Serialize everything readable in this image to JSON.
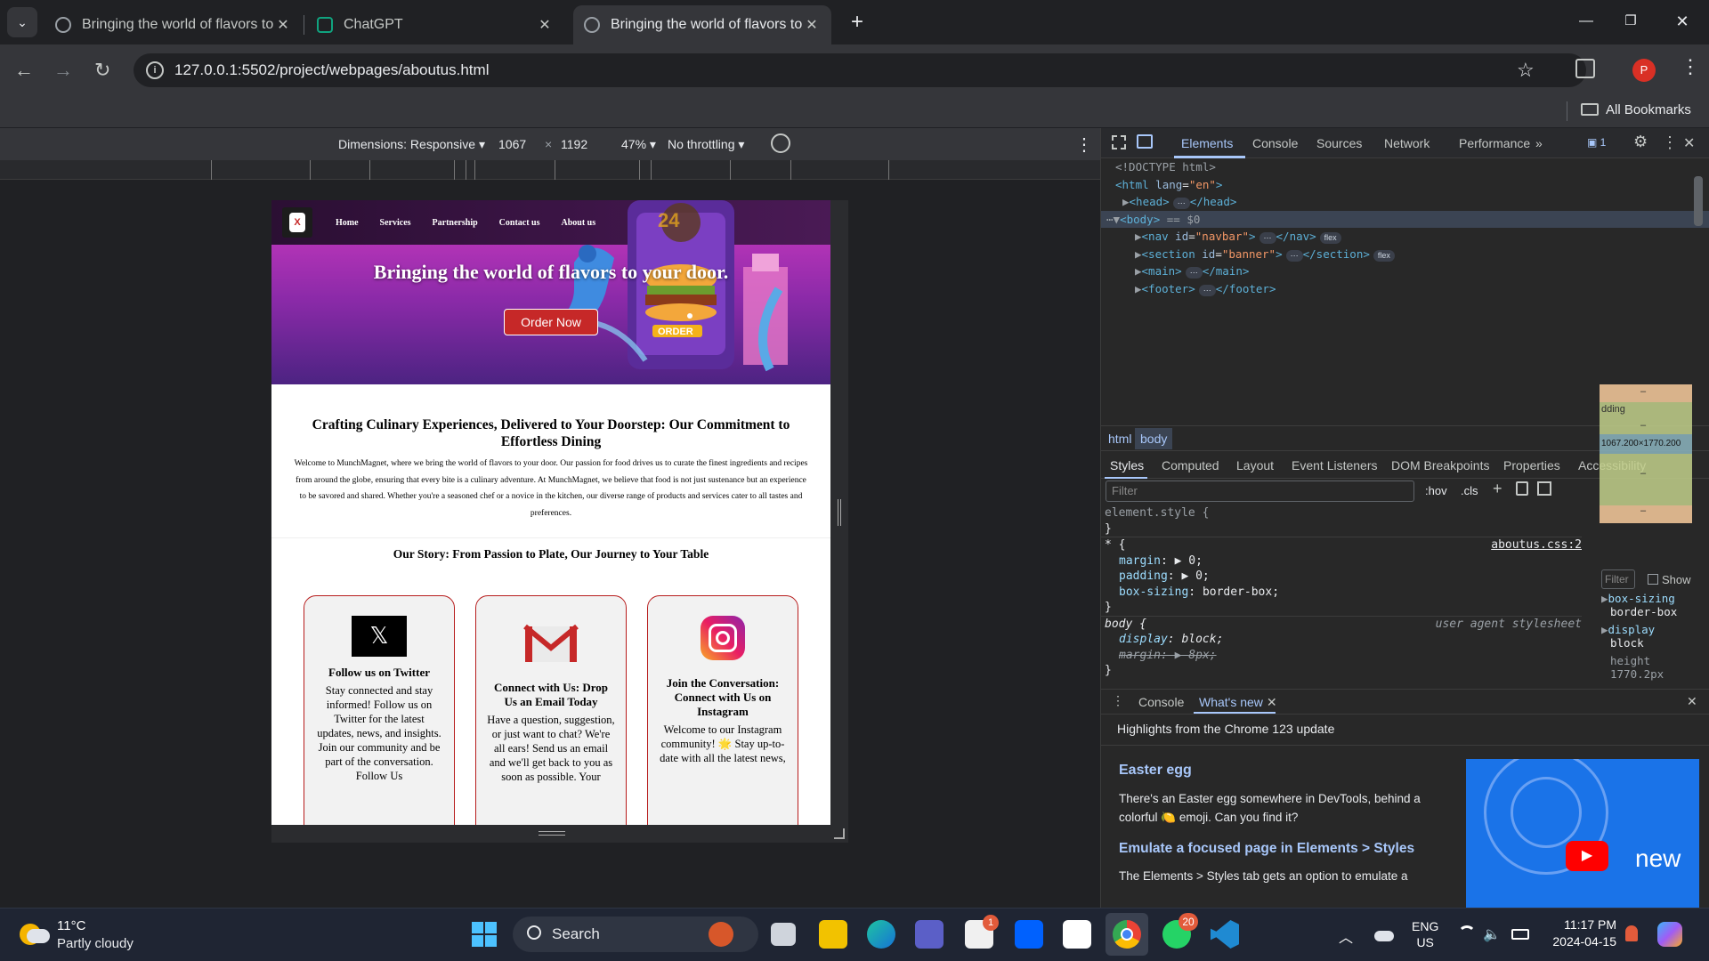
{
  "browser": {
    "tabs": [
      {
        "title": "Bringing the world of flavors to",
        "active": false
      },
      {
        "title": "ChatGPT",
        "active": false
      },
      {
        "title": "Bringing the world of flavors to",
        "active": true
      }
    ],
    "new_tab_icon": "+",
    "url": "127.0.0.1:5502/project/webpages/aboutus.html",
    "profile_initial": "P",
    "bookmarks_label": "All Bookmarks"
  },
  "device_toolbar": {
    "dimensions_label": "Dimensions: Responsive",
    "width": "1067",
    "times": "×",
    "height": "1192",
    "zoom": "47%",
    "throttling": "No throttling"
  },
  "page": {
    "logo_letter": "X",
    "nav": [
      "Home",
      "Services",
      "Partnership",
      "Contact us",
      "About us"
    ],
    "banner_title": "Bringing the world of flavors to your door.",
    "order_button": "Order Now",
    "badge_24": "24",
    "order_label": "ORDER",
    "intro_heading": "Crafting Culinary Experiences, Delivered to Your Doorstep: Our Commitment to Effortless Dining",
    "intro_text": "Welcome to MunchMagnet, where we bring the world of flavors to your door. Our passion for food drives us to curate the finest ingredients and recipes from around the globe, ensuring that every bite is a culinary adventure. At MunchMagnet, we believe that food is not just sustenance but an experience to be savored and shared. Whether you're a seasoned chef or a novice in the kitchen, our diverse range of products and services cater to all tastes and preferences.",
    "story_heading": "Our Story: From Passion to Plate, Our Journey to Your Table",
    "cards": [
      {
        "logo": "x-logo-icon",
        "logo_text": "𝕏",
        "title": "Follow us on Twitter",
        "text": "Stay connected and stay informed! Follow us on Twitter for the latest updates, news, and insights. Join our community and be part of the conversation. Follow Us"
      },
      {
        "logo": "gmail-logo-icon",
        "title": "Connect with Us: Drop Us an Email Today",
        "text": "Have a question, suggestion, or just want to chat? We're all ears! Send us an email and we'll get back to you as soon as possible. Your"
      },
      {
        "logo": "instagram-logo-icon",
        "title": "Join the Conversation: Connect with Us on Instagram",
        "text": "Welcome to our Instagram community! 🌟 Stay up-to-date with all the latest news,"
      }
    ]
  },
  "devtools": {
    "tabs": [
      "Elements",
      "Console",
      "Sources",
      "Network",
      "Performance"
    ],
    "active_tab": "Elements",
    "issues_count": "1",
    "dom": {
      "doctype": "<!DOCTYPE html>",
      "html_open": "<html",
      "html_attr": "lang",
      "html_val": "\"en\"",
      "head": "<head>",
      "head_close": "</head>",
      "body": "<body>",
      "body_suffix": "== $0",
      "nodes": [
        {
          "open": "<nav",
          "attr": "id",
          "val": "\"navbar\"",
          "close": "</nav>",
          "pill": "flex"
        },
        {
          "open": "<section",
          "attr": "id",
          "val": "\"banner\"",
          "close": "</section>",
          "pill": "flex"
        },
        {
          "open": "<main>",
          "attr": "",
          "val": "",
          "close": "</main>",
          "pill": ""
        },
        {
          "open": "<footer>",
          "attr": "",
          "val": "",
          "close": "</footer>",
          "pill": ""
        }
      ]
    },
    "breadcrumbs": [
      "html",
      "body"
    ],
    "styles_tabs": [
      "Styles",
      "Computed",
      "Layout",
      "Event Listeners",
      "DOM Breakpoints",
      "Properties",
      "Accessibility"
    ],
    "filter_placeholder": "Filter",
    "hov": ":hov",
    "cls": ".cls",
    "rules": {
      "element_style": "element.style {",
      "close": "}",
      "star_selector": "* {",
      "star_source": "aboutus.css:2",
      "margin_prop": "margin",
      "margin_val": "0;",
      "padding_prop": "padding",
      "padding_val": "0;",
      "boxsizing_prop": "box-sizing",
      "boxsizing_val": "border-box;",
      "body_selector": "body {",
      "body_source": "user agent stylesheet",
      "display_prop": "display",
      "display_val": "block;",
      "bmargin_prop": "margin",
      "bmargin_val": "8px;"
    },
    "box_model": {
      "dash": "–",
      "padding_label": "dding",
      "content_size": "1067.200×1770.200"
    },
    "computed": {
      "filter": "Filter",
      "show_all": "Show",
      "items": [
        {
          "prop": "box-sizing",
          "val": "border-box"
        },
        {
          "prop": "display",
          "val": "block"
        },
        {
          "prop": "height",
          "val": "1770.2px"
        }
      ]
    },
    "drawer": {
      "tabs": [
        "Console",
        "What's new"
      ],
      "highlights": "Highlights from the Chrome 123 update",
      "easter_title": "Easter egg",
      "easter_text": "There's an Easter egg somewhere in DevTools, behind a colorful 🍋 emoji. Can you find it?",
      "emulate_title": "Emulate a focused page in Elements > Styles",
      "emulate_text": "The Elements > Styles tab gets an option to emulate a",
      "video_text": "new"
    }
  },
  "taskbar": {
    "weather_temp": "11°C",
    "weather_desc": "Partly cloudy",
    "search": "Search",
    "store_badge": "1",
    "whatsapp_badge": "20",
    "lang1": "ENG",
    "lang2": "US",
    "time": "11:17 PM",
    "date": "2024-04-15"
  }
}
